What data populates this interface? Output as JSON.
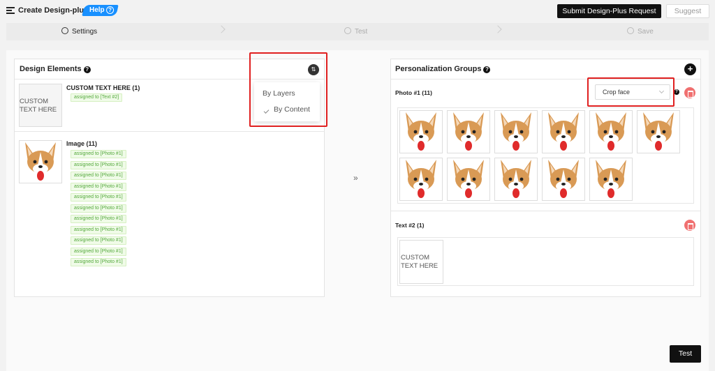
{
  "header": {
    "title": "Create Design-plus",
    "help_label": "Help",
    "submit_label": "Submit Design-Plus Request",
    "suggest_label": "Suggest"
  },
  "steps": [
    {
      "label": "Settings",
      "state": "active"
    },
    {
      "label": "Test",
      "state": "inactive"
    },
    {
      "label": "Save",
      "state": "inactive"
    }
  ],
  "design_elements": {
    "title": "Design Elements",
    "sort_menu": {
      "items": [
        {
          "label": "By Layers",
          "checked": false
        },
        {
          "label": "By Content",
          "checked": true
        }
      ]
    },
    "text_element": {
      "title": "CUSTOM TEXT HERE (1)",
      "preview_text": "CUSTOM TEXT HERE",
      "tags": [
        "assigned to [Text #2]"
      ]
    },
    "image_element": {
      "title": "Image (11)",
      "tags": [
        "assigned to [Photo #1]",
        "assigned to [Photo #1]",
        "assigned to [Photo #1]",
        "assigned to [Photo #1]",
        "assigned to [Photo #1]",
        "assigned to [Photo #1]",
        "assigned to [Photo #1]",
        "assigned to [Photo #1]",
        "assigned to [Photo #1]",
        "assigned to [Photo #1]",
        "assigned to [Photo #1]"
      ]
    }
  },
  "personalization": {
    "title": "Personalization Groups",
    "photo_group": {
      "title": "Photo #1 (11)",
      "crop_value": "Crop face",
      "image_count": 11
    },
    "text_group": {
      "title": "Text #2 (1)",
      "preview_text": "CUSTOM TEXT HERE"
    }
  },
  "footer": {
    "test_label": "Test"
  },
  "colors": {
    "accent_blue": "#1890ff",
    "highlight_red": "#e02020",
    "tag_green": "#52a83a",
    "delete_red": "#f07070"
  }
}
